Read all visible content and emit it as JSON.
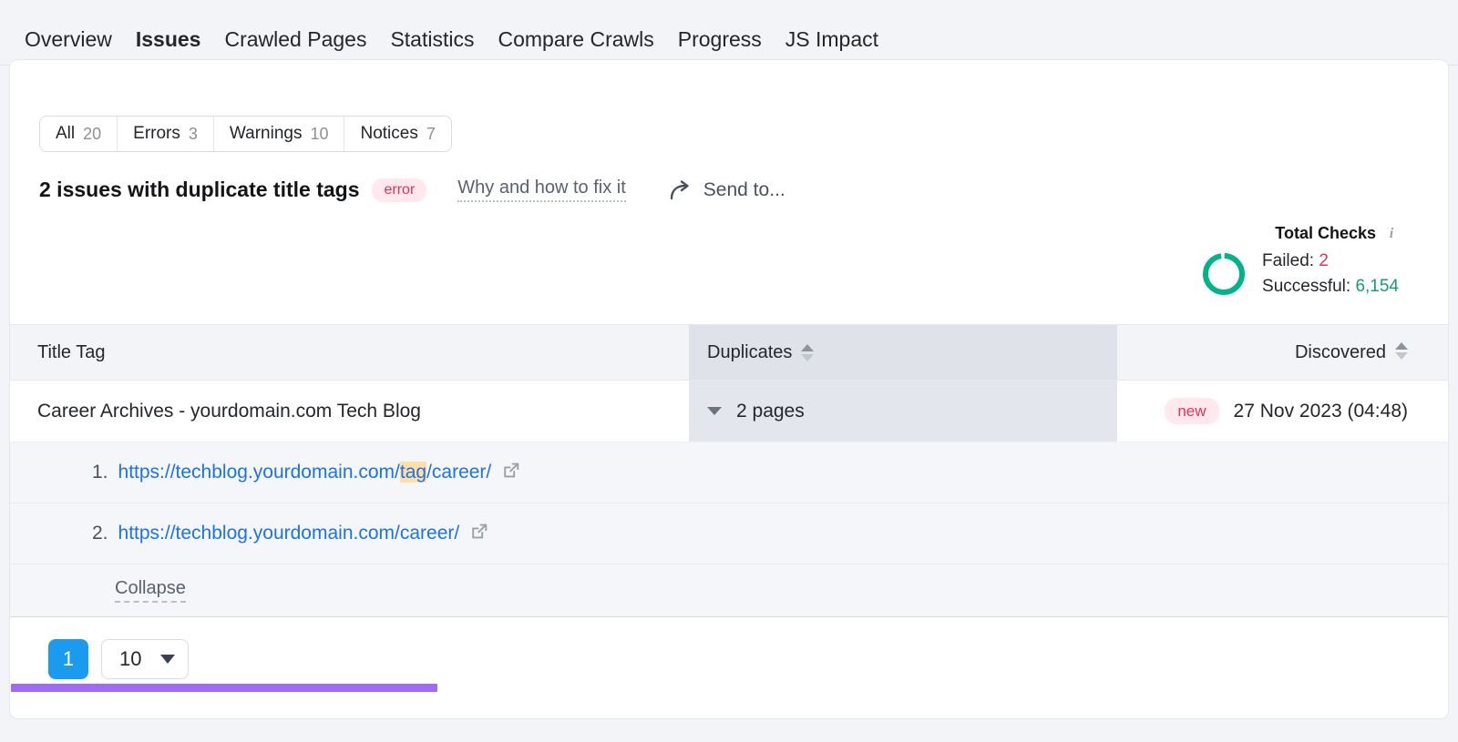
{
  "nav": {
    "tabs": [
      {
        "label": "Overview",
        "active": false
      },
      {
        "label": "Issues",
        "active": true
      },
      {
        "label": "Crawled Pages",
        "active": false
      },
      {
        "label": "Statistics",
        "active": false
      },
      {
        "label": "Compare Crawls",
        "active": false
      },
      {
        "label": "Progress",
        "active": false
      },
      {
        "label": "JS Impact",
        "active": false
      }
    ]
  },
  "filters": [
    {
      "label": "All",
      "count": "20"
    },
    {
      "label": "Errors",
      "count": "3"
    },
    {
      "label": "Warnings",
      "count": "10"
    },
    {
      "label": "Notices",
      "count": "7"
    }
  ],
  "issue": {
    "title": "2 issues with duplicate title tags",
    "severity_badge": "error",
    "why_link": "Why and how to fix it",
    "send_to": "Send to...",
    "send_to_icon": "share-arrow-icon"
  },
  "total_checks": {
    "title": "Total Checks",
    "info_icon": "info-icon",
    "failed_label": "Failed:",
    "failed_value": "2",
    "successful_label": "Successful:",
    "successful_value": "6,154",
    "donut_color": "#00b388",
    "failed_color": "#e4315c",
    "successful_color": "#159a7a",
    "success_fraction": 0.97
  },
  "table": {
    "columns": {
      "title_tag": "Title Tag",
      "duplicates": "Duplicates",
      "discovered": "Discovered"
    },
    "rows": [
      {
        "title_tag": "Career Archives - yourdomain.com Tech Blog",
        "duplicates": "2 pages",
        "expand_icon": "chevron-down-icon",
        "discovered_badge": "new",
        "discovered_date": "27 Nov 2023 (04:48)",
        "highlight_color": "#a169f7",
        "sub_rows": [
          {
            "index": "1.",
            "url_before": "https://techblog.yourdomain.com/",
            "url_highlight": "tag",
            "url_after": "/career/"
          },
          {
            "index": "2.",
            "url_before": "https://techblog.yourdomain.com/career/",
            "url_highlight": "",
            "url_after": ""
          }
        ],
        "collapse_label": "Collapse"
      }
    ]
  },
  "pagination": {
    "current_page": "1",
    "per_page": "10"
  }
}
